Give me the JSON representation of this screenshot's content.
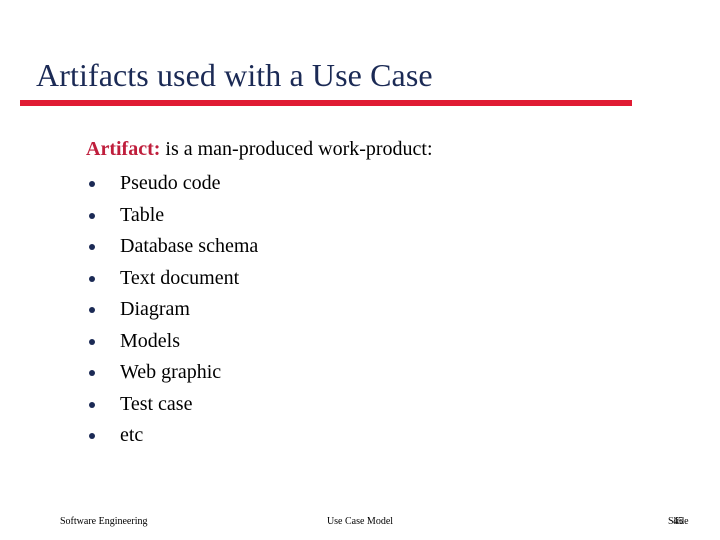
{
  "slide": {
    "title": "Artifacts used with a Use Case",
    "accent_rule_color": "#e01b33",
    "title_color": "#1b2a55"
  },
  "body": {
    "lead_term": "Artifact:",
    "lead_rest": " is a man-produced work-product:",
    "lead_term_color": "#bf1e3c",
    "bullet_color": "#1b2a55",
    "items": [
      {
        "label": "Pseudo code"
      },
      {
        "label": "Table"
      },
      {
        "label": "Database schema"
      },
      {
        "label": "Text document"
      },
      {
        "label": "Diagram"
      },
      {
        "label": "Models"
      },
      {
        "label": "Web graphic"
      },
      {
        "label": "Test case"
      },
      {
        "label": "etc"
      }
    ]
  },
  "footer": {
    "left": "Software Engineering",
    "center": "Use Case Model",
    "right_label": "Slide",
    "right_number": "45"
  }
}
